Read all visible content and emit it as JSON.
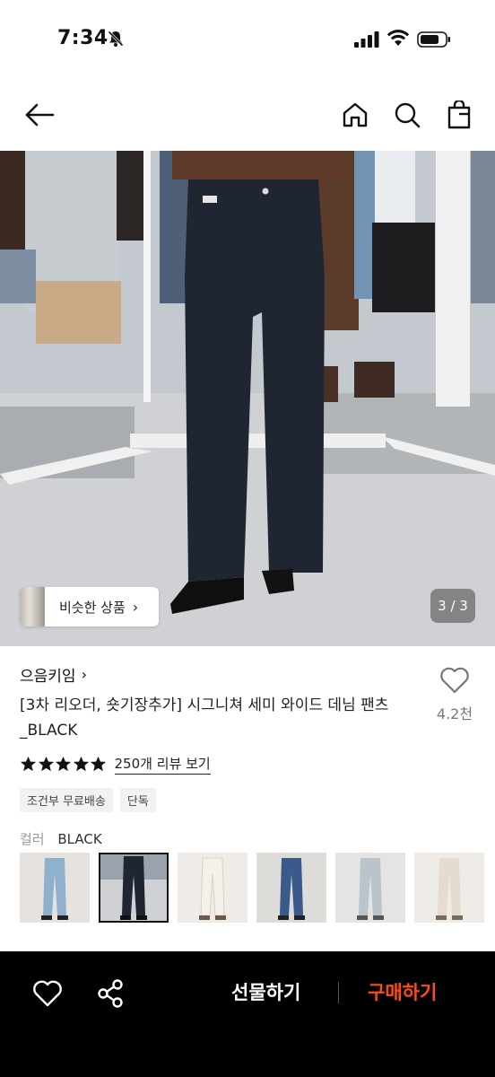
{
  "status_bar": {
    "time": "7:34"
  },
  "icons": {
    "back": "arrow-left-icon",
    "home": "home-icon",
    "search": "search-icon",
    "cart": "shopping-bag-icon",
    "wishlist": "heart-icon",
    "share": "share-icon",
    "rating_star": "star-icon"
  },
  "hero": {
    "similar_label": "비슷한 상품",
    "page_indicator": "3 / 3"
  },
  "product": {
    "brand": "으음키임",
    "title": "[3차 리오더, 숏기장추가] 시그니쳐 세미 와이드 데님 팬츠 _BLACK",
    "wish_count": "4.2천",
    "rating": 5,
    "review_link": "250개 리뷰 보기",
    "tags": [
      "조건부 무료배송",
      "단독"
    ],
    "option_label": "컬러",
    "option_value": "BLACK",
    "variants": [
      {
        "color": "light-blue",
        "selected": false
      },
      {
        "color": "black",
        "selected": true
      },
      {
        "color": "ivory",
        "selected": false
      },
      {
        "color": "indigo",
        "selected": false
      },
      {
        "color": "gray-blue",
        "selected": false
      },
      {
        "color": "beige",
        "selected": false
      }
    ]
  },
  "bottom_bar": {
    "gift_label": "선물하기",
    "buy_label": "구매하기"
  },
  "colors": {
    "accent": "#ff4a1c",
    "bottom_bar_bg": "#000000",
    "tag_bg": "#f2f2f2"
  }
}
